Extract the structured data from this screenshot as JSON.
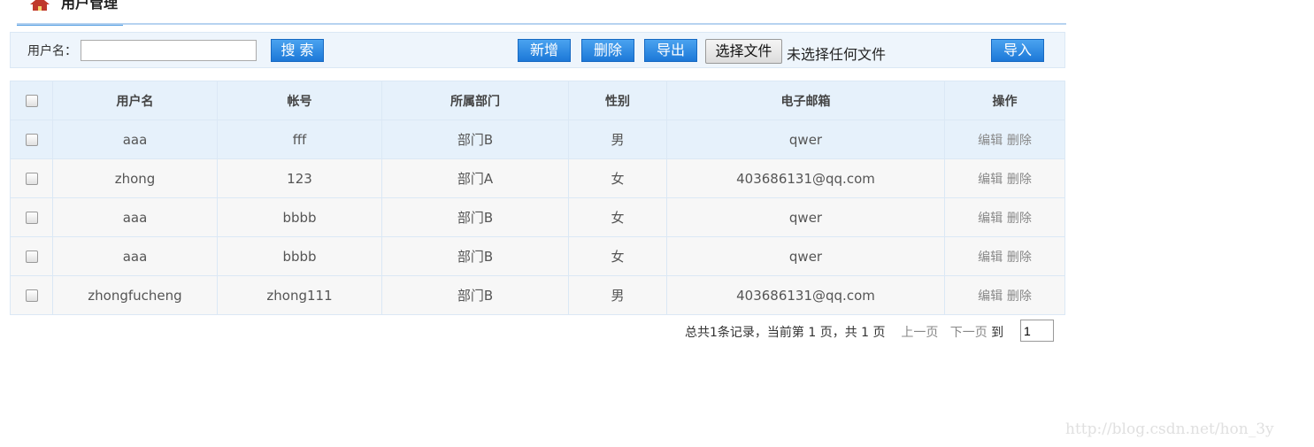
{
  "header": {
    "title": "用户管理",
    "icon": "home-icon"
  },
  "toolbar": {
    "username_label": "用户名：",
    "username_value": "",
    "search_label": "搜 索",
    "add_label": "新增",
    "delete_label": "删除",
    "export_label": "导出",
    "choose_file_label": "选择文件",
    "file_status": "未选择任何文件",
    "import_label": "导入"
  },
  "table": {
    "columns": [
      "用户名",
      "帐号",
      "所属部门",
      "性别",
      "电子邮箱",
      "操作"
    ],
    "rows": [
      {
        "username": "aaa",
        "account": "fff",
        "department": "部门B",
        "gender": "男",
        "email": "qwer",
        "edit": "编辑",
        "delete": "删除"
      },
      {
        "username": "zhong",
        "account": "123",
        "department": "部门A",
        "gender": "女",
        "email": "403686131@qq.com",
        "edit": "编辑",
        "delete": "删除"
      },
      {
        "username": "aaa",
        "account": "bbbb",
        "department": "部门B",
        "gender": "女",
        "email": "qwer",
        "edit": "编辑",
        "delete": "删除"
      },
      {
        "username": "aaa",
        "account": "bbbb",
        "department": "部门B",
        "gender": "女",
        "email": "qwer",
        "edit": "编辑",
        "delete": "删除"
      },
      {
        "username": "zhongfucheng",
        "account": "zhong111",
        "department": "部门B",
        "gender": "男",
        "email": "403686131@qq.com",
        "edit": "编辑",
        "delete": "删除"
      }
    ]
  },
  "pagination": {
    "summary": "总共1条记录，当前第 1 页，共 1 页",
    "prev_label": "上一页",
    "next_label": "下一页",
    "goto_label": "到",
    "page_value": "1"
  },
  "watermark": "http://blog.csdn.net/hon_3y",
  "colors": {
    "accent": "#4d9ae0",
    "button": "#1c78d8",
    "header_bg": "#e6f1fb"
  }
}
